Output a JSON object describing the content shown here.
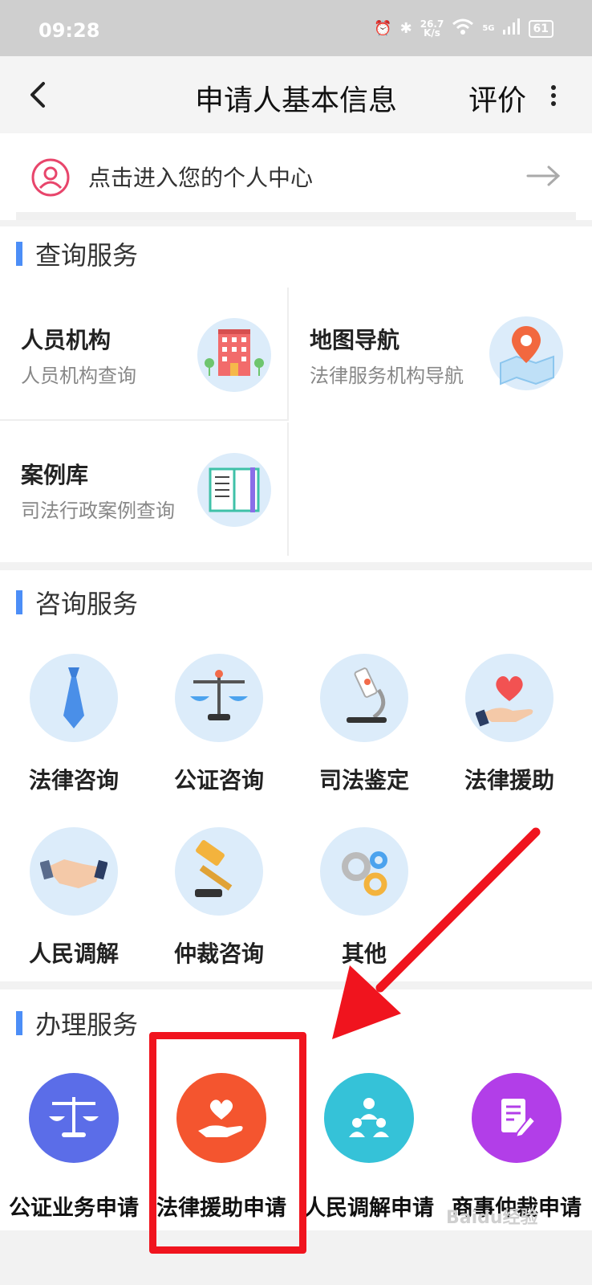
{
  "status_bar": {
    "time": "09:28",
    "net_speed_value": "26.7",
    "net_speed_unit": "K/s",
    "signal": "5G",
    "battery": "61"
  },
  "nav": {
    "title": "申请人基本信息",
    "rate": "评价"
  },
  "profile": {
    "label": "点击进入您的个人中心"
  },
  "query_services": {
    "title": "查询服务",
    "items": [
      {
        "name": "人员机构",
        "desc": "人员机构查询",
        "icon": "building-icon"
      },
      {
        "name": "地图导航",
        "desc": "法律服务机构导航",
        "icon": "map-pin-icon"
      },
      {
        "name": "案例库",
        "desc": "司法行政案例查询",
        "icon": "book-icon"
      }
    ]
  },
  "consult_services": {
    "title": "咨询服务",
    "items": [
      {
        "label": "法律咨询",
        "icon": "tie-icon"
      },
      {
        "label": "公证咨询",
        "icon": "scale-icon"
      },
      {
        "label": "司法鉴定",
        "icon": "microscope-icon"
      },
      {
        "label": "法律援助",
        "icon": "heart-hand-icon"
      },
      {
        "label": "人民调解",
        "icon": "handshake-icon"
      },
      {
        "label": "仲裁咨询",
        "icon": "gavel-icon"
      },
      {
        "label": "其他",
        "icon": "gears-icon"
      }
    ]
  },
  "handle_services": {
    "title": "办理服务",
    "items": [
      {
        "label": "公证业务申请",
        "icon": "scale-icon",
        "color": "#5b6de8"
      },
      {
        "label": "法律援助申请",
        "icon": "heart-hand-icon",
        "color": "#f4552f"
      },
      {
        "label": "人民调解申请",
        "icon": "people-icon",
        "color": "#35c2d8"
      },
      {
        "label": "商事仲裁申请",
        "icon": "edit-doc-icon",
        "color": "#b23ee8"
      }
    ]
  },
  "annotation": {
    "highlight_color": "#f0141e"
  },
  "watermark": "Baidu经验"
}
